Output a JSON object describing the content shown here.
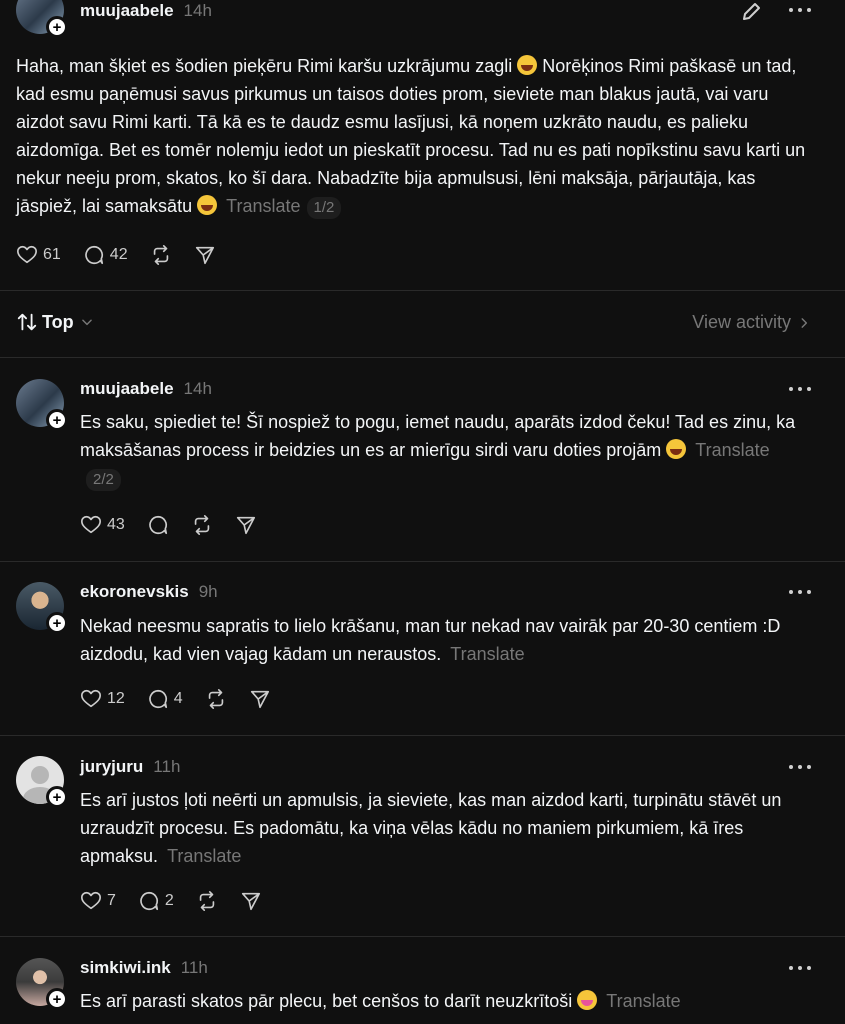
{
  "main_post": {
    "username": "muujaabele",
    "time": "14h",
    "text": "Haha, man šķiet es šodien pieķēru Rimi karšu uzkrājumu zagli",
    "text2": "Norēķinos Rimi paškasē un tad, kad esmu paņēmusi savus pirkumus un taisos doties prom, sieviete man blakus jautā, vai varu aizdot savu Rimi karti. Tā kā es te daudz esmu lasījusi, kā noņem uzkrāto naudu, es palieku aizdomīga. Bet es tomēr nolemju iedot un pieskatīt procesu. Tad nu es pati nopīkstinu savu karti un nekur neeju prom, skatos, ko šī dara. Nabadzīte bija apmulsusi, lēni maksāja, pārjautāja, kas jāspiež, lai samaksātu",
    "translate": "Translate",
    "pager": "1/2",
    "likes": "61",
    "comments": "42"
  },
  "sort": {
    "label": "Top",
    "view_activity": "View activity"
  },
  "replies": [
    {
      "username": "muujaabele",
      "time": "14h",
      "text": "Es saku, spiediet te! Šī nospiež to pogu, iemet naudu, aparāts izdod čeku! Tad es zinu, ka maksāšanas process ir beidzies un es ar mierīgu sirdi varu doties projām",
      "translate": "Translate",
      "pager": "2/2",
      "likes": "43",
      "comments": ""
    },
    {
      "username": "ekoronevskis",
      "time": "9h",
      "text": "Nekad neesmu sapratis to lielo krāšanu, man tur nekad nav vairāk par 20-30 centiem :D aizdodu, kad vien vajag kādam un neraustos.",
      "translate": "Translate",
      "likes": "12",
      "comments": "4"
    },
    {
      "username": "juryjuru",
      "time": "11h",
      "text": "Es arī justos ļoti neērti un apmulsis, ja sieviete, kas man aizdod karti, turpinātu stāvēt un uzraudzīt procesu. Es padomātu, ka viņa vēlas kādu no maniem pirkumiem, kā īres apmaksu.",
      "translate": "Translate",
      "likes": "7",
      "comments": "2"
    },
    {
      "username": "simkiwi.ink",
      "time": "11h",
      "text": "Es arī parasti skatos pār plecu, bet cenšos to darīt neuzkrītoši",
      "translate": "Translate"
    }
  ],
  "icons": {
    "like": "heart-icon",
    "comment": "comment-icon",
    "repost": "repost-icon",
    "share": "send-icon",
    "edit": "pencil-icon",
    "more": "more-icon",
    "follow": "plus-icon",
    "sort": "sort-icon",
    "chevron": "chevron-icon"
  }
}
